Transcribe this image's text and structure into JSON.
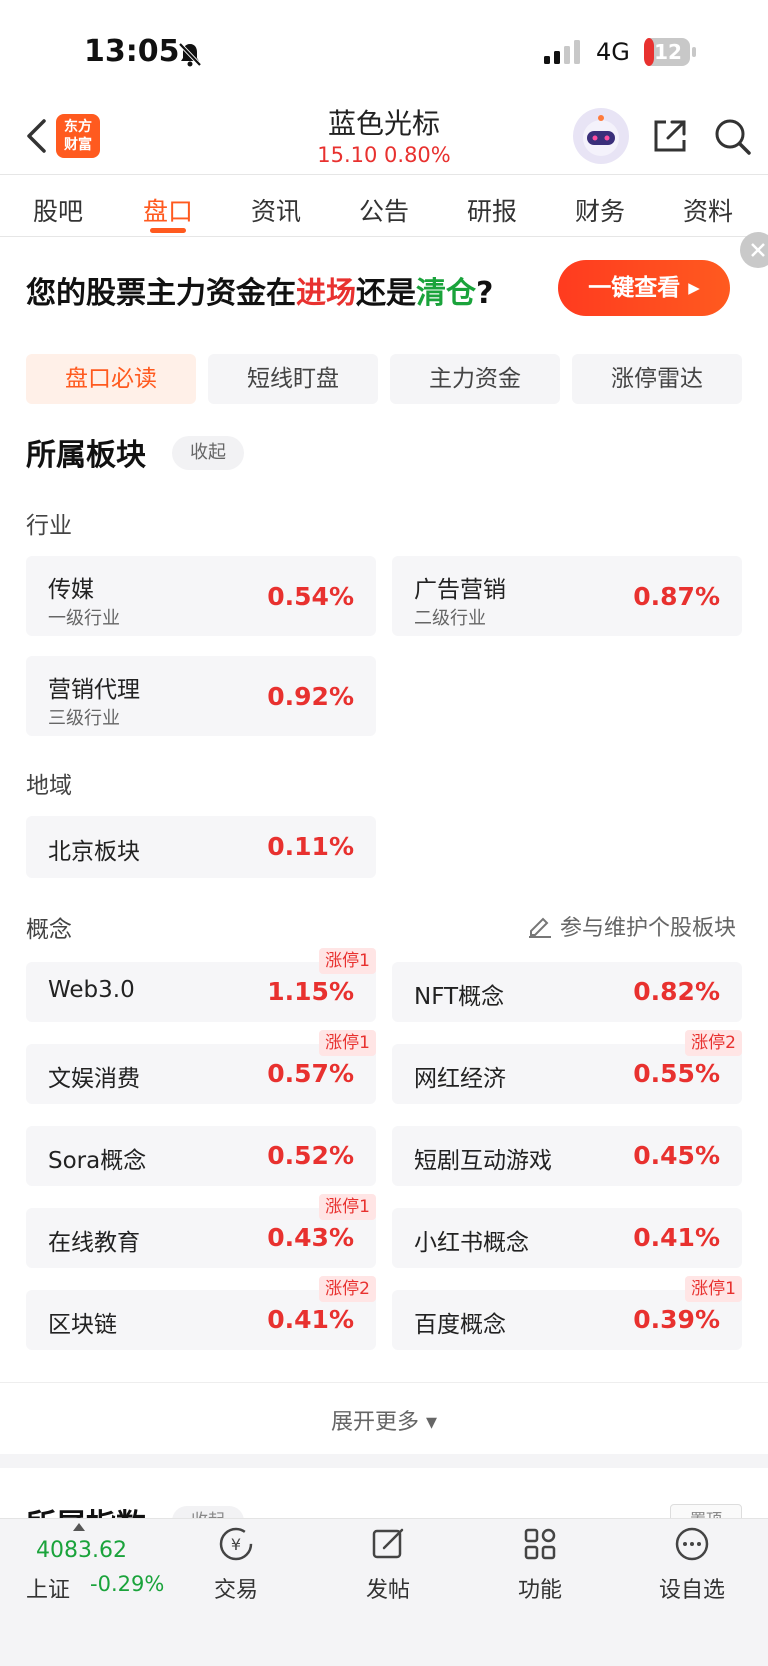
{
  "status_bar": {
    "time": "13:05",
    "network": "4G",
    "battery": "12"
  },
  "header": {
    "logo_line1": "东方",
    "logo_line2": "财富",
    "stock_name": "蓝色光标",
    "stock_price": "15.10  0.80%"
  },
  "tabs": [
    {
      "label": "股吧"
    },
    {
      "label": "盘口"
    },
    {
      "label": "资讯"
    },
    {
      "label": "公告"
    },
    {
      "label": "研报"
    },
    {
      "label": "财务"
    },
    {
      "label": "资料"
    }
  ],
  "banner": {
    "text_a": "您的股票主力资金在",
    "text_b": "进场",
    "text_c": "还是",
    "text_d": "清仓",
    "text_e": "?",
    "button": "一键查看 ▸"
  },
  "subtabs": [
    {
      "label": "盘口必读"
    },
    {
      "label": "短线盯盘"
    },
    {
      "label": "主力资金"
    },
    {
      "label": "涨停雷达"
    }
  ],
  "section": {
    "title": "所属板块",
    "collapse": "收起"
  },
  "industry": {
    "label": "行业",
    "items": [
      {
        "name": "传媒",
        "level": "一级行业",
        "pct": "0.54%"
      },
      {
        "name": "广告营销",
        "level": "二级行业",
        "pct": "0.87%"
      },
      {
        "name": "营销代理",
        "level": "三级行业",
        "pct": "0.92%"
      }
    ]
  },
  "region": {
    "label": "地域",
    "items": [
      {
        "name": "北京板块",
        "pct": "0.11%"
      }
    ]
  },
  "concept": {
    "label": "概念",
    "maintain": "参与维护个股板块",
    "items": [
      {
        "name": "Web3.0",
        "pct": "1.15%",
        "tag": "涨停1"
      },
      {
        "name": "NFT概念",
        "pct": "0.82%",
        "tag": ""
      },
      {
        "name": "文娱消费",
        "pct": "0.57%",
        "tag": "涨停1"
      },
      {
        "name": "网红经济",
        "pct": "0.55%",
        "tag": "涨停2"
      },
      {
        "name": "Sora概念",
        "pct": "0.52%",
        "tag": ""
      },
      {
        "name": "短剧互动游戏",
        "pct": "0.45%",
        "tag": ""
      },
      {
        "name": "在线教育",
        "pct": "0.43%",
        "tag": "涨停1"
      },
      {
        "name": "小红书概念",
        "pct": "0.41%",
        "tag": ""
      },
      {
        "name": "区块链",
        "pct": "0.41%",
        "tag": "涨停2"
      },
      {
        "name": "百度概念",
        "pct": "0.39%",
        "tag": "涨停1"
      }
    ]
  },
  "expand_more": "展开更多 ▾",
  "next_section": {
    "title": "所属指数",
    "collapse": "收起",
    "right": "置顶"
  },
  "bottom": {
    "index_value": "4083.62",
    "index_name": "上证",
    "index_change": "-0.29%",
    "nav": [
      {
        "label": "交易"
      },
      {
        "label": "发帖"
      },
      {
        "label": "功能"
      },
      {
        "label": "设自选"
      }
    ]
  },
  "colors": {
    "accent": "#ff5a1f",
    "up": "#e8312f",
    "down": "#1aa33b"
  }
}
